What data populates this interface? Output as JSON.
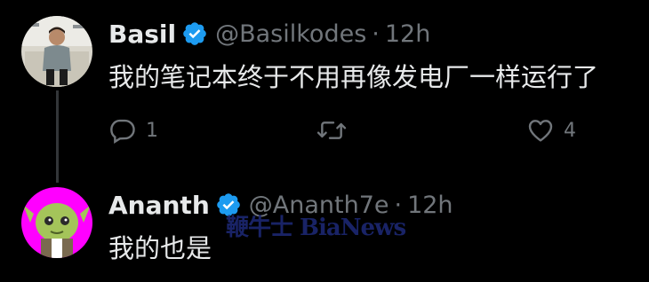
{
  "colors": {
    "background": "#000000",
    "text_primary": "#e7e9ea",
    "text_secondary": "#71767b",
    "verified_badge": "#1d9bf0",
    "thread_line": "#333639",
    "avatar2_bg": "#ff00ff"
  },
  "tweets": [
    {
      "display_name": "Basil",
      "verified_icon": "verified-badge-icon",
      "handle": "@Basilkodes",
      "separator": "·",
      "time": "12h",
      "text": "我的笔记本终于不用再像发电厂一样运行了",
      "actions": {
        "reply": {
          "icon": "reply-icon",
          "count": "1"
        },
        "retweet": {
          "icon": "retweet-icon",
          "count": ""
        },
        "like": {
          "icon": "heart-icon",
          "count": "4"
        }
      }
    },
    {
      "display_name": "Ananth",
      "verified_icon": "verified-badge-icon",
      "handle": "@Ananth7e",
      "separator": "·",
      "time": "12h",
      "text": "我的也是"
    }
  ],
  "watermark": "鞭牛士 BiaNews"
}
